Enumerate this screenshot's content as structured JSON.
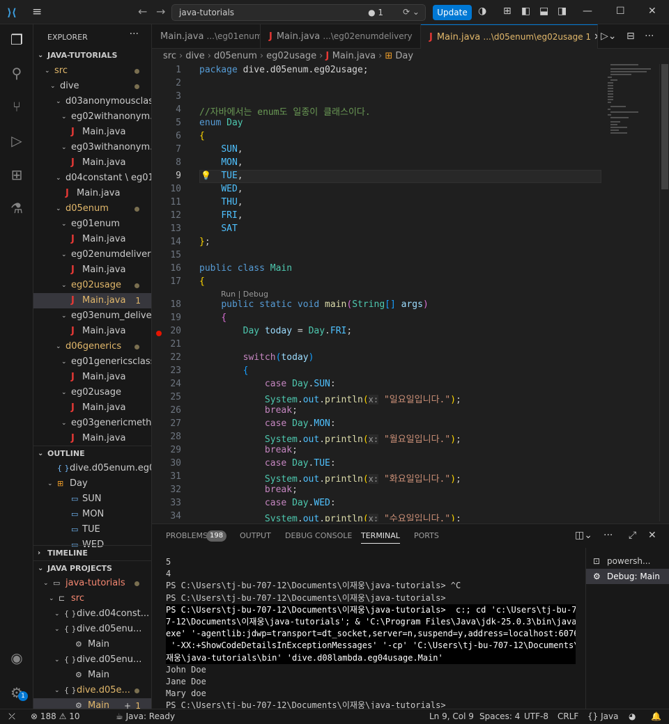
{
  "titlebar": {
    "command_center": "java-tutorials",
    "command_count": "1",
    "update_label": "Update"
  },
  "sidebar": {
    "title": "EXPLORER",
    "root": "JAVA-TUTORIALS",
    "tree": [
      {
        "label": "src",
        "depth": 1,
        "kind": "folder",
        "open": true,
        "state": "orange",
        "dot": true
      },
      {
        "label": "dive",
        "depth": 2,
        "kind": "folder",
        "open": true,
        "state": "",
        "dot": true
      },
      {
        "label": "d03anonymousclass",
        "depth": 3,
        "kind": "folder",
        "open": true,
        "state": "",
        "dot": false
      },
      {
        "label": "eg02withanonym...",
        "depth": 4,
        "kind": "folder",
        "open": true,
        "state": "",
        "dot": false
      },
      {
        "label": "Main.java",
        "depth": 5,
        "kind": "java",
        "state": "",
        "dot": false
      },
      {
        "label": "eg03withanonym...",
        "depth": 4,
        "kind": "folder",
        "open": true,
        "state": "",
        "dot": false
      },
      {
        "label": "Main.java",
        "depth": 5,
        "kind": "java",
        "state": "",
        "dot": false
      },
      {
        "label": "d04constant \\ eg01...",
        "depth": 3,
        "kind": "folder",
        "open": true,
        "state": "",
        "dot": false
      },
      {
        "label": "Main.java",
        "depth": 4,
        "kind": "java",
        "state": "",
        "dot": false
      },
      {
        "label": "d05enum",
        "depth": 3,
        "kind": "folder",
        "open": true,
        "state": "orange",
        "dot": true
      },
      {
        "label": "eg01enum",
        "depth": 4,
        "kind": "folder",
        "open": true,
        "state": "",
        "dot": false
      },
      {
        "label": "Main.java",
        "depth": 5,
        "kind": "java",
        "state": "",
        "dot": false
      },
      {
        "label": "eg02enumdelivery",
        "depth": 4,
        "kind": "folder",
        "open": true,
        "state": "",
        "dot": false
      },
      {
        "label": "Main.java",
        "depth": 5,
        "kind": "java",
        "state": "",
        "dot": false
      },
      {
        "label": "eg02usage",
        "depth": 4,
        "kind": "folder",
        "open": true,
        "state": "orange",
        "dot": true
      },
      {
        "label": "Main.java",
        "depth": 5,
        "kind": "java",
        "state": "orange sel",
        "dot": false,
        "num": "1"
      },
      {
        "label": "eg03enum_delivery",
        "depth": 4,
        "kind": "folder",
        "open": true,
        "state": "",
        "dot": false
      },
      {
        "label": "Main.java",
        "depth": 5,
        "kind": "java",
        "state": "",
        "dot": false
      },
      {
        "label": "d06generics",
        "depth": 3,
        "kind": "folder",
        "open": true,
        "state": "orange",
        "dot": true
      },
      {
        "label": "eg01genericsclass",
        "depth": 4,
        "kind": "folder",
        "open": true,
        "state": "",
        "dot": false
      },
      {
        "label": "Main.java",
        "depth": 5,
        "kind": "java",
        "state": "",
        "dot": false
      },
      {
        "label": "eg02usage",
        "depth": 4,
        "kind": "folder",
        "open": true,
        "state": "",
        "dot": false
      },
      {
        "label": "Main.java",
        "depth": 5,
        "kind": "java",
        "state": "",
        "dot": false
      },
      {
        "label": "eg03genericmeth...",
        "depth": 4,
        "kind": "folder",
        "open": true,
        "state": "",
        "dot": false
      },
      {
        "label": "Main.java",
        "depth": 5,
        "kind": "java",
        "state": "",
        "dot": false
      }
    ],
    "outline_title": "OUTLINE",
    "outline": [
      {
        "label": "dive.d05enum.eg0...",
        "icon": "{ }",
        "depth": 1,
        "type": "pkg"
      },
      {
        "label": "Day",
        "icon": "⊞",
        "depth": 1,
        "type": "enum",
        "open": true
      },
      {
        "label": "SUN",
        "icon": "▭",
        "depth": 2,
        "type": "member"
      },
      {
        "label": "MON",
        "icon": "▭",
        "depth": 2,
        "type": "member"
      },
      {
        "label": "TUE",
        "icon": "▭",
        "depth": 2,
        "type": "member"
      },
      {
        "label": "WED",
        "icon": "▭",
        "depth": 2,
        "type": "member"
      }
    ],
    "timeline_title": "TIMELINE",
    "projects_title": "JAVA PROJECTS",
    "projects": [
      {
        "label": "java-tutorials",
        "icon": "▭",
        "depth": 1,
        "state": "red",
        "dot": true,
        "open": true
      },
      {
        "label": "src",
        "icon": "⊏",
        "depth": 2,
        "state": "red",
        "dot": false,
        "open": true
      },
      {
        "label": "dive.d04const...",
        "icon": "{ }",
        "depth": 3,
        "state": "",
        "dot": false,
        "open": true
      },
      {
        "label": "dive.d05enu...",
        "icon": "{ }",
        "depth": 3,
        "state": "",
        "dot": false,
        "open": true
      },
      {
        "label": "Main",
        "icon": "⚙",
        "depth": 5,
        "state": "",
        "dot": false
      },
      {
        "label": "dive.d05enu...",
        "icon": "{ }",
        "depth": 3,
        "state": "",
        "dot": false,
        "open": true
      },
      {
        "label": "Main",
        "icon": "⚙",
        "depth": 5,
        "state": "",
        "dot": false
      },
      {
        "label": "dive.d05e...",
        "icon": "{ }",
        "depth": 3,
        "state": "orange",
        "dot": true,
        "open": true
      },
      {
        "label": "Main",
        "icon": "⚙",
        "depth": 5,
        "state": "orange sel",
        "dot": false,
        "num": "1",
        "extra": "+"
      }
    ]
  },
  "tabs": [
    {
      "name": "Main.java",
      "desc": "...\\eg01enum",
      "active": false,
      "icon": false
    },
    {
      "name": "Main.java",
      "desc": "...\\eg02enumdelivery",
      "active": false,
      "icon": true
    },
    {
      "name": "Main.java",
      "desc": "...\\d05enum\\eg02usage 1",
      "active": true,
      "icon": true
    }
  ],
  "breadcrumb": [
    "src",
    "dive",
    "d05enum",
    "eg02usage",
    "Main.java",
    "Day"
  ],
  "code_lines": [
    "<span class=\"kw\">package</span> <span class=\"pl\">dive.d05enum.eg02usage;</span>",
    "",
    "",
    "<span class=\"cm\">//자바에서는 enum도 일종이 클래스이다.</span>",
    "<span class=\"kw\">enum</span> <span class=\"ty\">Day</span>",
    "<span class=\"br1\">{</span>",
    "    <span class=\"co\">SUN</span>,",
    "    <span class=\"co\">MON</span>,",
    "    <span class=\"co\">TUE</span>,",
    "    <span class=\"co\">WED</span>,",
    "    <span class=\"co\">THU</span>,",
    "    <span class=\"co\">FRI</span>,",
    "    <span class=\"co\">SAT</span>",
    "<span class=\"br1\">}</span>;",
    "",
    "<span class=\"kw\">public</span> <span class=\"kw\">class</span> <span class=\"ty\">Main</span>",
    "<span class=\"br1\">{</span>",
    "    <span class=\"kw\">public</span> <span class=\"kw\">static</span> <span class=\"kw\">void</span> <span class=\"fn\">main</span><span class=\"br2\">(</span><span class=\"ty\">String</span><span class=\"br3\">[]</span> <span class=\"pm\">args</span><span class=\"br2\">)</span>",
    "    <span class=\"br2\">{</span>",
    "        <span class=\"ty\">Day</span> <span class=\"pm\">today</span> = <span class=\"ty\">Day</span>.<span class=\"co\">FRI</span>;",
    "",
    "        <span class=\"kc\">switch</span><span class=\"br3\">(</span><span class=\"pm\">today</span><span class=\"br3\">)</span>",
    "        <span class=\"br3\">{</span>",
    "            <span class=\"kc\">case</span> <span class=\"ty\">Day</span>.<span class=\"co\">SUN</span>:",
    "            <span class=\"ty\">System</span>.<span class=\"co\">out</span>.<span class=\"fn\">println</span><span class=\"br1\">(</span><span class=\"hint\">x:</span> <span class=\"st\">\"일요일입니다.\"</span><span class=\"br1\">)</span>;",
    "            <span class=\"kc\">break</span>;",
    "            <span class=\"kc\">case</span> <span class=\"ty\">Day</span>.<span class=\"co\">MON</span>:",
    "            <span class=\"ty\">System</span>.<span class=\"co\">out</span>.<span class=\"fn\">println</span><span class=\"br1\">(</span><span class=\"hint\">x:</span> <span class=\"st\">\"월요일입니다.\"</span><span class=\"br1\">)</span>;",
    "            <span class=\"kc\">break</span>;",
    "            <span class=\"kc\">case</span> <span class=\"ty\">Day</span>.<span class=\"co\">TUE</span>:",
    "            <span class=\"ty\">System</span>.<span class=\"co\">out</span>.<span class=\"fn\">println</span><span class=\"br1\">(</span><span class=\"hint\">x:</span> <span class=\"st\">\"화요일입니다.\"</span><span class=\"br1\">)</span>;",
    "            <span class=\"kc\">break</span>;",
    "            <span class=\"kc\">case</span> <span class=\"ty\">Day</span>.<span class=\"co\">WED</span>:",
    "            <span class=\"ty\">System</span>.<span class=\"co\">out</span>.<span class=\"fn\">println</span><span class=\"br1\">(</span><span class=\"hint\">x:</span> <span class=\"st\">\"수요일입니다.\"</span><span class=\"br1\">)</span>;"
  ],
  "line_numbers": [
    "1",
    "2",
    "3",
    "4",
    "5",
    "6",
    "7",
    "8",
    "9",
    "10",
    "11",
    "12",
    "13",
    "14",
    "15",
    "16",
    "17",
    "18",
    "19",
    "20",
    "21",
    "22",
    "23",
    "24",
    "25",
    "26",
    "27",
    "28",
    "29",
    "30",
    "31",
    "32",
    "33",
    "34"
  ],
  "codelens": "Run | Debug",
  "panel": {
    "tabs": [
      "PROBLEMS",
      "OUTPUT",
      "DEBUG CONSOLE",
      "TERMINAL",
      "PORTS"
    ],
    "problems_count": "198",
    "terminal_lines": [
      "5",
      "4",
      "PS C:\\Users\\tj-bu-707-12\\Documents\\이재웅\\java-tutorials> ^C",
      "PS C:\\Users\\tj-bu-707-12\\Documents\\이재웅\\java-tutorials>",
      "PS C:\\Users\\tj-bu-707-12\\Documents\\이재웅\\java-tutorials>  c:; cd 'c:\\Users\\tj-bu-70",
      "7-12\\Documents\\이재웅\\java-tutorials'; & 'C:\\Program Files\\Java\\jdk-25.0.3\\bin\\java.",
      "exe' '-agentlib:jdwp=transport=dt_socket,server=n,suspend=y,address=localhost:60761'",
      " '-XX:+ShowCodeDetailsInExceptionMessages' '-cp' 'C:\\Users\\tj-bu-707-12\\Documents\\이",
      "재웅\\java-tutorials\\bin' 'dive.d08lambda.eg04usage.Main'",
      "John Doe",
      "Jane Doe",
      "Mary doe",
      "PS C:\\Users\\tj-bu-707-12\\Documents\\이재웅\\java-tutorials>"
    ],
    "terminal_list": [
      "powersh...",
      "Debug: Main"
    ]
  },
  "statusbar": {
    "errors": "188",
    "warnings": "10",
    "java": "Java: Ready",
    "position": "Ln 9, Col 9",
    "spaces": "Spaces: 4",
    "encoding": "UTF-8",
    "eol": "CRLF",
    "language": "Java"
  },
  "activity_badge": "1",
  "colors": {
    "accent": "#0078d4",
    "modified": "#e2b86b",
    "error": "#f48771",
    "java_icon": "#e53935"
  }
}
